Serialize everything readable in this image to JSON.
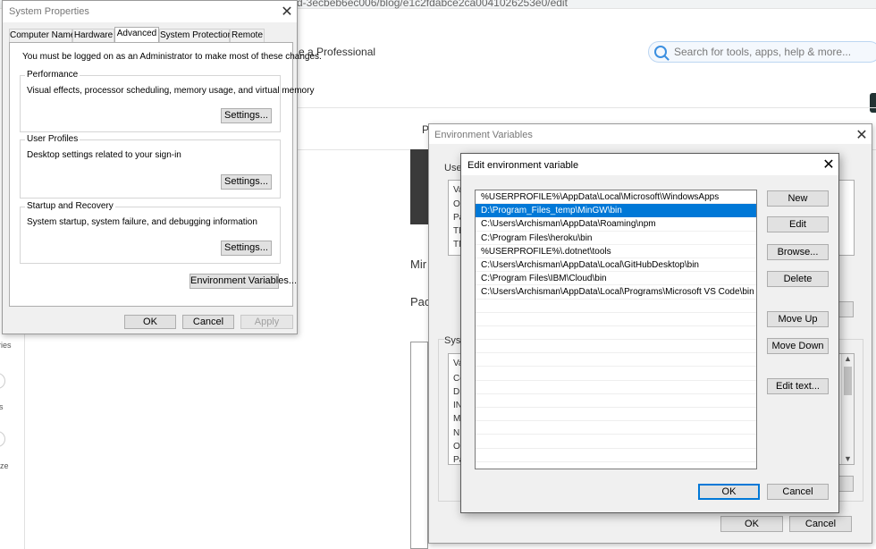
{
  "browser": {
    "url_fragment": "d-3ecbeb6ec006/blog/e1c2fdabce2ca0041026253e0/edit",
    "promo_text": "e a Professional",
    "search_placeholder": "Search for tools, apps, help & more...",
    "left_texts": [
      "ries",
      "s",
      "ize"
    ],
    "content_letters": {
      "p": "P",
      "min": "Mir",
      "pac": "Pac"
    }
  },
  "system_properties": {
    "title": "System Properties",
    "tabs": [
      "Computer Name",
      "Hardware",
      "Advanced",
      "System Protection",
      "Remote"
    ],
    "active_tab": "Advanced",
    "notice": "You must be logged on as an Administrator to make most of these changes.",
    "performance": {
      "label": "Performance",
      "desc": "Visual effects, processor scheduling, memory usage, and virtual memory",
      "button": "Settings..."
    },
    "user_profiles": {
      "label": "User Profiles",
      "desc": "Desktop settings related to your sign-in",
      "button": "Settings..."
    },
    "startup_recovery": {
      "label": "Startup and Recovery",
      "desc": "System startup, system failure, and debugging information",
      "button": "Settings..."
    },
    "env_button": "Environment Variables...",
    "ok": "OK",
    "cancel": "Cancel",
    "apply": "Apply"
  },
  "environment_variables": {
    "title": "Environment Variables",
    "user_label": "User",
    "system_label": "Syste",
    "user_rows": [
      "Va",
      "On",
      "Pa",
      "TE",
      "TM"
    ],
    "system_rows": [
      "Va",
      "Co",
      "Dr",
      "IN",
      "MI",
      "NU",
      "OS",
      "Pa"
    ],
    "ok": "OK",
    "cancel": "Cancel"
  },
  "edit_env": {
    "title": "Edit environment variable",
    "paths": [
      "%USERPROFILE%\\AppData\\Local\\Microsoft\\WindowsApps",
      "D:\\Program_Files_temp\\MinGW\\bin",
      "C:\\Users\\Archisman\\AppData\\Roaming\\npm",
      "C:\\Program Files\\heroku\\bin",
      "%USERPROFILE%\\.dotnet\\tools",
      "C:\\Users\\Archisman\\AppData\\Local\\GitHubDesktop\\bin",
      "C:\\Program Files\\IBM\\Cloud\\bin",
      "C:\\Users\\Archisman\\AppData\\Local\\Programs\\Microsoft VS Code\\bin"
    ],
    "selected_index": 1,
    "buttons": {
      "new": "New",
      "edit": "Edit",
      "browse": "Browse...",
      "delete": "Delete",
      "move_up": "Move Up",
      "move_down": "Move Down",
      "edit_text": "Edit text...",
      "ok": "OK",
      "cancel": "Cancel"
    }
  }
}
